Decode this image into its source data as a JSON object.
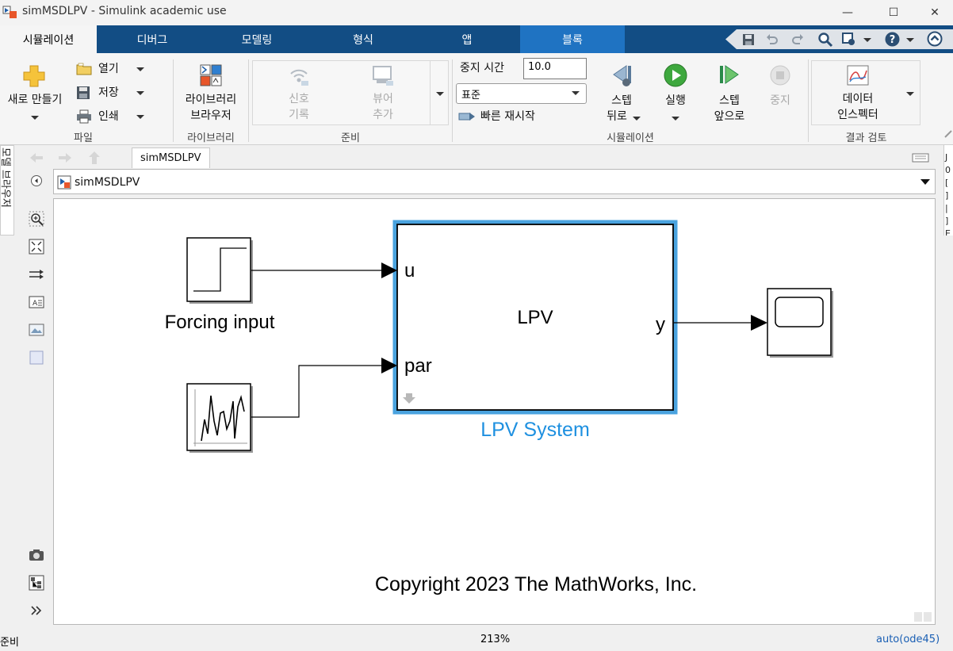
{
  "window": {
    "title": "simMSDLPV - Simulink academic use",
    "minimize_glyph": "—",
    "maximize_glyph": "☐",
    "close_glyph": "✕"
  },
  "ribbon_tabs": [
    {
      "label": "시뮬레이션"
    },
    {
      "label": "디버그"
    },
    {
      "label": "모델링"
    },
    {
      "label": "형식"
    },
    {
      "label": "앱"
    },
    {
      "label": "블록"
    }
  ],
  "file_section": {
    "new_label": "새로 만들기",
    "open_label": "열기",
    "save_label": "저장",
    "print_label": "인쇄",
    "section": "파일"
  },
  "library_section": {
    "browser_line1": "라이브러리",
    "browser_line2": "브라우저",
    "section": "라이브러리"
  },
  "prepare_section": {
    "log_signals_line1": "신호",
    "log_signals_line2": "기록",
    "add_viewer_line1": "뷰어",
    "add_viewer_line2": "추가",
    "section": "준비"
  },
  "simulation_section": {
    "stop_time_label": "중지 시간",
    "stop_time_value": "10.0",
    "mode_value": "표준",
    "fast_restart_label": "빠른 재시작",
    "step_back_line1": "스텝",
    "step_back_line2": "뒤로",
    "run_label": "실행",
    "step_forward_line1": "스텝",
    "step_forward_line2": "앞으로",
    "stop_label": "중지",
    "section": "시뮬레이션"
  },
  "review_section": {
    "data_inspector_line1": "데이터",
    "data_inspector_line2": "인스펙터",
    "section": "결과 검토"
  },
  "side_panel": {
    "model_browser": "모델 브라우저",
    "right_glyphs": "J 0 [ ] | ] E"
  },
  "editor": {
    "tab_label": "simMSDLPV",
    "breadcrumb": "simMSDLPV"
  },
  "diagram": {
    "forcing_block_label": "Forcing input",
    "lpv_block_title": "LPV",
    "lpv_port_u": "u",
    "lpv_port_par": "par",
    "lpv_port_y": "y",
    "lpv_block_name": "LPV System",
    "copyright": "Copyright 2023 The MathWorks, Inc."
  },
  "status": {
    "state": "준비",
    "zoom": "213%",
    "solver": "auto(ode45)"
  },
  "colors": {
    "tab_bar": "#124d84",
    "active_tab_highlight": "#1f73c2",
    "selected_block": "#4aa3df",
    "block_name": "#1e90e0",
    "solver_link": "#1a5fb4"
  }
}
